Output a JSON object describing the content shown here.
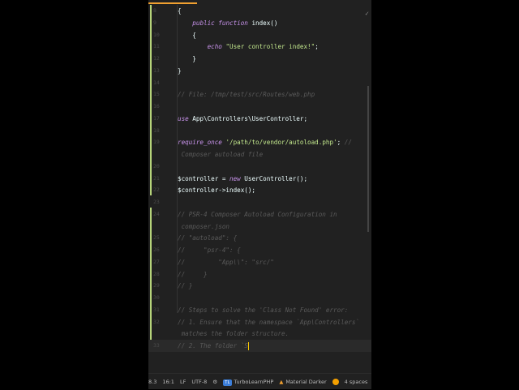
{
  "lines": [
    {
      "n": "8",
      "html": "{"
    },
    {
      "n": "9",
      "html": "    <span class='kw'>public function</span> index()"
    },
    {
      "n": "10",
      "html": "    {"
    },
    {
      "n": "11",
      "html": "        <span class='kw'>echo</span> <span class='str'>\"User controller index!\"</span>;"
    },
    {
      "n": "12",
      "html": "    }"
    },
    {
      "n": "13",
      "html": "}"
    },
    {
      "n": "14",
      "html": ""
    },
    {
      "n": "15",
      "html": "<span class='cm'>// File: /tmp/test/src/Routes/web.php</span>"
    },
    {
      "n": "16",
      "html": ""
    },
    {
      "n": "17",
      "html": "<span class='kw'>use</span> App\\Controllers\\UserController;"
    },
    {
      "n": "18",
      "html": ""
    },
    {
      "n": "19",
      "html": "<span class='kw'>require_once</span> <span class='str'>'/path/to/vendor/autoload.php'</span>; <span class='cm'>//</span>"
    },
    {
      "n": "",
      "html": "<span class='cm'> Composer autoload file</span>"
    },
    {
      "n": "20",
      "html": ""
    },
    {
      "n": "21",
      "html": "$controller = <span class='kw'>new</span> UserController();"
    },
    {
      "n": "22",
      "html": "$controller->index();"
    },
    {
      "n": "23",
      "html": ""
    },
    {
      "n": "24",
      "html": "<span class='cm'>// PSR-4 Composer Autoload Configuration in</span>"
    },
    {
      "n": "",
      "html": "<span class='cm'> composer.json</span>"
    },
    {
      "n": "25",
      "html": "<span class='cm'>// \"autoload\": {</span>"
    },
    {
      "n": "26",
      "html": "<span class='cm'>//     \"psr-4\": {</span>"
    },
    {
      "n": "27",
      "html": "<span class='cm'>//         \"App\\\\\": \"src/\"</span>"
    },
    {
      "n": "28",
      "html": "<span class='cm'>//     }</span>"
    },
    {
      "n": "29",
      "html": "<span class='cm'>// }</span>"
    },
    {
      "n": "30",
      "html": ""
    },
    {
      "n": "31",
      "html": "<span class='cm'>// Steps to solve the 'Class Not Found' error:</span>"
    },
    {
      "n": "32",
      "html": "<span class='cm'>// 1. Ensure that the namespace `App\\Controllers`</span>"
    },
    {
      "n": "",
      "html": "<span class='cm'> matches the folder structure.</span>"
    },
    {
      "n": "33",
      "html": "<span class='cm'>// 2. The folder `S</span>"
    }
  ],
  "status": {
    "php_version": "8.3",
    "position": "16:1",
    "line_ending": "LF",
    "encoding": "UTF-8",
    "plugin_badge": "TL",
    "plugin": "TurboLearnPHP",
    "theme": "Material Darker",
    "indent": "4 spaces"
  }
}
